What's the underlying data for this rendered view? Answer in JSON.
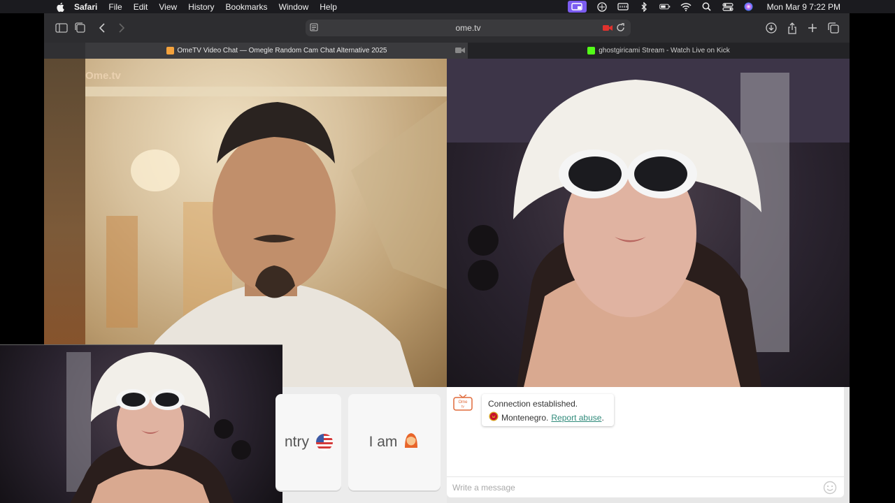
{
  "menubar": {
    "app_name": "Safari",
    "menus": [
      "File",
      "Edit",
      "View",
      "History",
      "Bookmarks",
      "Window",
      "Help"
    ],
    "clock": "Mon Mar 9  7:22 PM",
    "status_icons": [
      "screen-share-icon",
      "vpn-icon",
      "keyboard-icon",
      "bluetooth-icon",
      "battery-icon",
      "wifi-icon",
      "search-icon",
      "control-center-icon",
      "siri-icon"
    ]
  },
  "browser": {
    "url": "ome.tv",
    "tabs": [
      {
        "title": "OmeTV Video Chat — Omegle Random Cam Chat Alternative 2025",
        "active": true
      },
      {
        "title": "ghostgiricami Stream - Watch Live on Kick",
        "active": false
      }
    ]
  },
  "video": {
    "watermark": "Ome.tv"
  },
  "filters": {
    "country_label": "ntry",
    "gender_label": "I am"
  },
  "chat": {
    "logo_text": "Ome tv",
    "status_line1": "Connection established.",
    "country": "Montenegro.",
    "report_label": "Report abuse",
    "report_suffix": ".",
    "input_placeholder": "Write a message"
  },
  "colors": {
    "accent_purple": "#7b5cf0",
    "report_link": "#2f8a7a",
    "recording_red": "#e0322e",
    "kick_green": "#53fc18"
  }
}
